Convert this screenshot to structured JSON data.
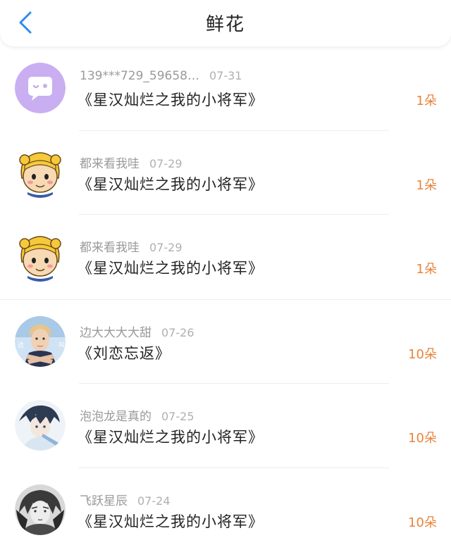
{
  "header": {
    "title": "鲜花"
  },
  "rows": [
    {
      "user": "139***729_59658…",
      "date": "07-31",
      "book": "《星汉灿烂之我的小将军》",
      "count": "1朵"
    },
    {
      "user": "都来看我哇",
      "date": "07-29",
      "book": "《星汉灿烂之我的小将军》",
      "count": "1朵"
    },
    {
      "user": "都来看我哇",
      "date": "07-29",
      "book": "《星汉灿烂之我的小将军》",
      "count": "1朵"
    },
    {
      "user": "边大大大大甜",
      "date": "07-26",
      "book": "《刘恋忘返》",
      "count": "10朵"
    },
    {
      "user": "泡泡龙是真的",
      "date": "07-25",
      "book": "《星汉灿烂之我的小将军》",
      "count": "10朵"
    },
    {
      "user": "飞跃星辰",
      "date": "07-24",
      "book": "《星汉灿烂之我的小将军》",
      "count": "10朵"
    }
  ],
  "colors": {
    "accent": "#e8833a",
    "back_arrow": "#2b8cf2"
  },
  "icons": {
    "back": "chevron-left-icon",
    "avatars": [
      "chat-bubble-avatar",
      "cartoon-girl-avatar",
      "cartoon-girl-avatar",
      "person-photo-avatar",
      "anime-boy-avatar",
      "sketch-portrait-avatar"
    ]
  }
}
